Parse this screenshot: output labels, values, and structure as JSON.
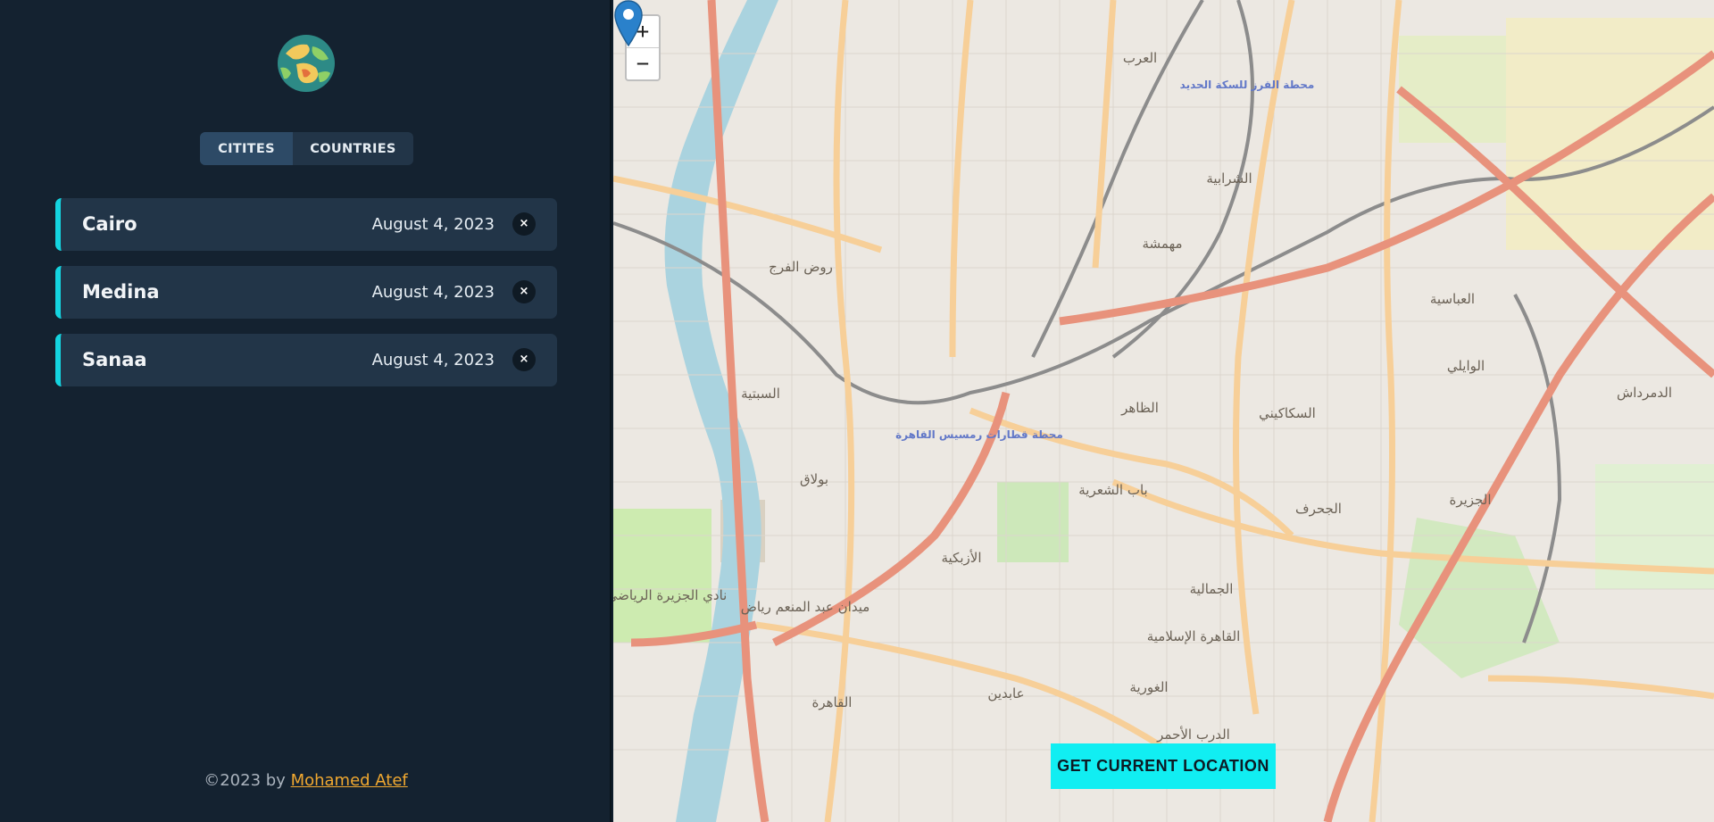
{
  "sidebar": {
    "tabs": [
      {
        "label": "CITITES",
        "active": true
      },
      {
        "label": "COUNTRIES",
        "active": false
      }
    ],
    "cities": [
      {
        "name": "Cairo",
        "date": "August 4, 2023",
        "delete_label": "×"
      },
      {
        "name": "Medina",
        "date": "August 4, 2023",
        "delete_label": "×"
      },
      {
        "name": "Sanaa",
        "date": "August 4, 2023",
        "delete_label": "×"
      }
    ],
    "footer": {
      "prefix": "©2023 by",
      "author": "Mohamed Atef"
    },
    "logo_icon": "globe-icon"
  },
  "map": {
    "zoom_in_label": "+",
    "zoom_out_label": "−",
    "current_location_label": "GET CURRENT LOCATION",
    "labels": {
      "station": "محطة قطارات رمسيس القاهرة",
      "shubra": "روض الفرج",
      "sabtiya": "السبتية",
      "bulaq": "بولاق",
      "zaher": "الظاهر",
      "sakakini": "السكاكيني",
      "azbakiya": "الأزبكية",
      "bab_shaariya": "باب الشعرية",
      "gamaliya": "الجمالية",
      "islamic_cairo": "القاهرة الإسلامية",
      "cairo": "القاهرة",
      "abdeen": "عابدين",
      "darrasa": "الدرب الأحمر",
      "sharabiya": "الشرابية",
      "abbasiya": "العباسية",
      "waili": "الوايلي",
      "demerdash": "الدمرداش",
      "zamalek_club": "نادي الجزيرة الرياضي",
      "ghuriya": "الغورية",
      "qalaa": "مهمشة",
      "arab": "العرب",
      "gezira": "الجزيرة",
      "zeitoun": "الجحرف",
      "tahrir_sq": "ميدان عبد المنعم رياض",
      "qubba_station": "محطة القرز للسكة الحديد"
    },
    "colors": {
      "accent": "#11eef2",
      "marker": "#2a81cb",
      "river": "#aad3df",
      "major_road": "#e8927c",
      "secondary_road": "#fcd6a4"
    }
  }
}
